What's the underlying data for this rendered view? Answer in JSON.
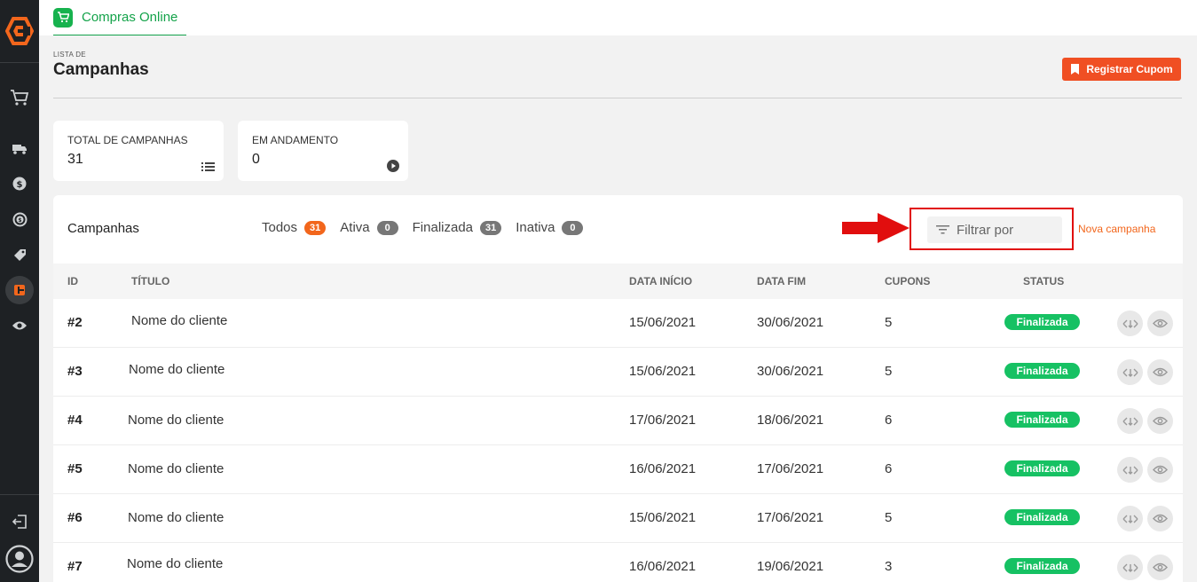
{
  "colors": {
    "sidebar_bg": "#1e2124",
    "brand_orange": "#f2661c",
    "primary_button": "#f04f23",
    "tab_green": "#14a34a",
    "status_green": "#16c163",
    "highlight_red": "#e10e0e"
  },
  "sidebar": {
    "logo": "brand-logo",
    "items": [
      {
        "icon": "cart-icon"
      },
      {
        "icon": "truck-icon"
      },
      {
        "icon": "dollar-icon"
      },
      {
        "icon": "exchange-money-icon"
      },
      {
        "icon": "tag-icon"
      },
      {
        "icon": "campaign-icon",
        "active": true
      },
      {
        "icon": "eye-icon"
      }
    ],
    "bottom": [
      {
        "icon": "logout-icon"
      },
      {
        "icon": "user-avatar-icon"
      }
    ]
  },
  "topbar": {
    "tab": {
      "icon": "cart-icon",
      "label": "Compras Online"
    }
  },
  "header": {
    "eyebrow": "LISTA DE",
    "title": "Campanhas",
    "register_button": "Registrar Cupom"
  },
  "stats": [
    {
      "label": "TOTAL DE CAMPANHAS",
      "value": "31",
      "icon": "list-icon"
    },
    {
      "label": "EM ANDAMENTO",
      "value": "0",
      "icon": "play-icon"
    }
  ],
  "campaigns": {
    "title": "Campanhas",
    "filters": [
      {
        "label": "Todos",
        "count": "31",
        "active": true
      },
      {
        "label": "Ativa",
        "count": "0"
      },
      {
        "label": "Finalizada",
        "count": "31"
      },
      {
        "label": "Inativa",
        "count": "0"
      }
    ],
    "filter_placeholder": "Filtrar por",
    "new_campaign": "Nova campanha",
    "columns": [
      "ID",
      "TÍTULO",
      "DATA INÍCIO",
      "DATA FIM",
      "CUPONS",
      "STATUS"
    ],
    "rows": [
      {
        "id": "#2",
        "title": "Nome do cliente",
        "start": "15/06/2021",
        "end": "30/06/2021",
        "coupons": "5",
        "status": "Finalizada"
      },
      {
        "id": "#3",
        "title": "Nome do cliente",
        "start": "15/06/2021",
        "end": "30/06/2021",
        "coupons": "5",
        "status": "Finalizada"
      },
      {
        "id": "#4",
        "title": "Nome do cliente",
        "start": "17/06/2021",
        "end": "18/06/2021",
        "coupons": "6",
        "status": "Finalizada"
      },
      {
        "id": "#5",
        "title": "Nome do cliente",
        "start": "16/06/2021",
        "end": "17/06/2021",
        "coupons": "6",
        "status": "Finalizada"
      },
      {
        "id": "#6",
        "title": "Nome do cliente",
        "start": "15/06/2021",
        "end": "17/06/2021",
        "coupons": "5",
        "status": "Finalizada"
      },
      {
        "id": "#7",
        "title": "Nome do cliente",
        "start": "16/06/2021",
        "end": "19/06/2021",
        "coupons": "3",
        "status": "Finalizada"
      }
    ]
  }
}
